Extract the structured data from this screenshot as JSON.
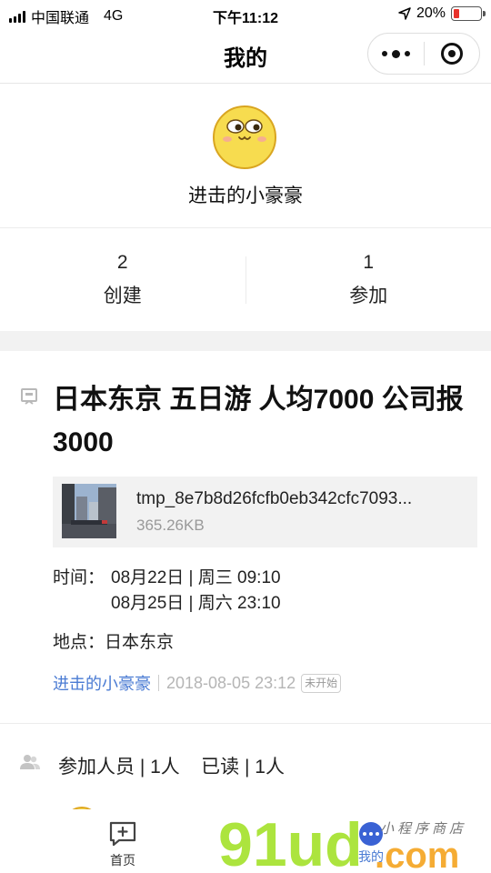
{
  "status_bar": {
    "carrier": "中国联通",
    "network": "4G",
    "time": "下午11:12",
    "battery_percent": "20%",
    "battery_level": 0.2
  },
  "nav": {
    "title": "我的"
  },
  "profile": {
    "username": "进击的小豪豪"
  },
  "stats": [
    {
      "count": "2",
      "label": "创建"
    },
    {
      "count": "1",
      "label": "参加"
    }
  ],
  "activity": {
    "title": "日本东京 五日游 人均7000 公司报3000",
    "file": {
      "name": "tmp_8e7b8d26fcfb0eb342cfc7093...",
      "size": "365.26KB"
    },
    "time_label": "时间：",
    "start_time": "08月22日 | 周三 09:10",
    "end_time": "08月25日 | 周六 23:10",
    "location": "地点：日本东京",
    "creator": "进击的小豪豪",
    "created_at": "2018-08-05 23:12",
    "status": "未开始"
  },
  "participants": {
    "text": "参加人员 | 1人    已读 | 1人"
  },
  "tab_bar": {
    "items": [
      {
        "label": "首页",
        "icon": "chat-add-icon"
      },
      {
        "label": "我的",
        "icon": "more-dots-icon"
      }
    ],
    "active_color": "#4a7bd3"
  },
  "watermark": {
    "brand": "91ud",
    "suffix": ".com",
    "tagline": "小程序商店"
  }
}
